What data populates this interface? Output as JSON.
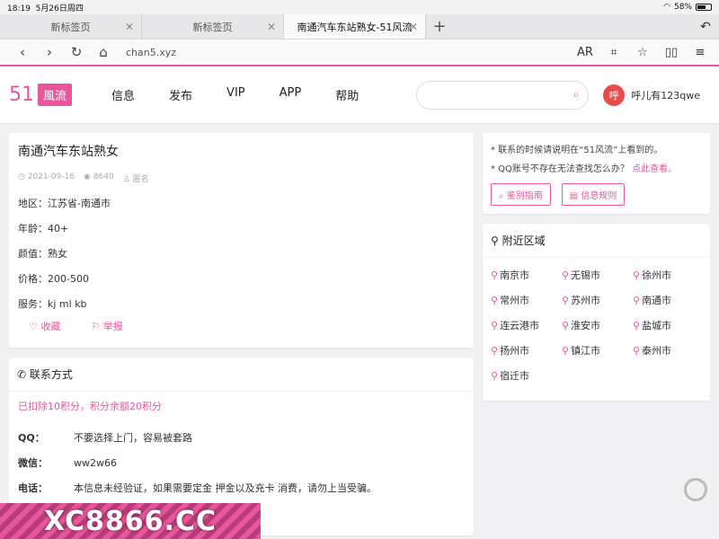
{
  "status": {
    "time": "18:19",
    "date": "5月26日周四",
    "battery": "58%",
    "battery_level": 0.58
  },
  "tabs": [
    {
      "label": "新标签页",
      "active": false
    },
    {
      "label": "新标签页",
      "active": false
    },
    {
      "label": "南通汽车东站熟女-51风流",
      "active": true
    }
  ],
  "toolbar": {
    "url": "chan5.xyz",
    "ar": "AR"
  },
  "site": {
    "logo_num": "51",
    "logo_tag": "風流",
    "nav": [
      "信息",
      "发布",
      "VIP",
      "APP",
      "帮助"
    ],
    "user_avatar": "呼",
    "user_name": "呼儿有123qwe"
  },
  "post": {
    "title": "南通汽车东站熟女",
    "date": "2021-09-16",
    "views": "8640",
    "author": "匿名",
    "fields": [
      {
        "key": "地区：",
        "value": "江苏省-南通市"
      },
      {
        "key": "年龄：",
        "value": "40+"
      },
      {
        "key": "颜值：",
        "value": "熟女"
      },
      {
        "key": "价格：",
        "value": "200-500"
      },
      {
        "key": "服务：",
        "value": "kj ml kb"
      }
    ],
    "favorite_label": "收藏",
    "report_label": "举报"
  },
  "contact": {
    "heading": "联系方式",
    "deduct_notice": "已扣除10积分，积分余额20积分",
    "rows": [
      {
        "key": "QQ：",
        "value": "不要选择上门，容易被套路"
      },
      {
        "key": "微信：",
        "value": "ww2w66"
      },
      {
        "key": "电话：",
        "value": "本信息未经验证，如果需要定金 押金以及充卡 消费，请勿上当受骗。"
      }
    ]
  },
  "tips": {
    "line1": "* 联系的时候请说明在“51风流”上看到的。",
    "line2": "* QQ账号不存在无法查找怎么办？",
    "line2_link": "点此查看。",
    "btn_guide": "鉴别指南",
    "btn_rules": "信息规则"
  },
  "region": {
    "heading": "附近区域",
    "cities": [
      "南京市",
      "无锡市",
      "徐州市",
      "常州市",
      "苏州市",
      "南通市",
      "连云港市",
      "淮安市",
      "盐城市",
      "扬州市",
      "镇江市",
      "泰州市",
      "宿迁市"
    ]
  },
  "banner": {
    "text": "XC8866.CC"
  },
  "colors": {
    "accent": "#e7579a",
    "avatar": "#e94b4b"
  }
}
